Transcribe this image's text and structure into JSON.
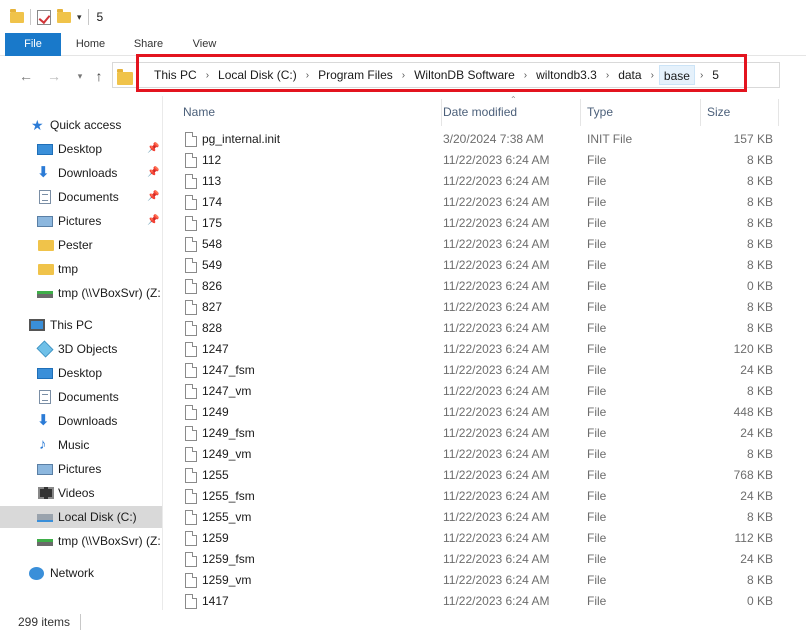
{
  "window": {
    "title": "5",
    "quick_access_dropdown": "▾"
  },
  "ribbon": {
    "tabs": [
      {
        "label": "File"
      },
      {
        "label": "Home"
      },
      {
        "label": "Share"
      },
      {
        "label": "View"
      }
    ]
  },
  "address": {
    "crumbs": [
      "This PC",
      "Local Disk (C:)",
      "Program Files",
      "WiltonDB Software",
      "wiltondb3.3",
      "data",
      "base",
      "5"
    ],
    "active_crumb": "base",
    "highlight_color": "#e3141f"
  },
  "nav": {
    "items": [
      {
        "label": "Quick access",
        "icon": "star-icon",
        "pinned": false
      },
      {
        "label": "Desktop",
        "icon": "desktop-icon",
        "pinned": true
      },
      {
        "label": "Downloads",
        "icon": "download-icon",
        "pinned": true
      },
      {
        "label": "Documents",
        "icon": "documents-icon",
        "pinned": true
      },
      {
        "label": "Pictures",
        "icon": "pictures-icon",
        "pinned": true
      },
      {
        "label": "Pester",
        "icon": "folder-icon",
        "pinned": false
      },
      {
        "label": "tmp",
        "icon": "folder-icon",
        "pinned": false
      },
      {
        "label": "tmp (\\\\VBoxSvr) (Z:",
        "icon": "network-drive-icon",
        "pinned": false
      },
      {
        "label": "This PC",
        "icon": "computer-icon",
        "pinned": false
      },
      {
        "label": "3D Objects",
        "icon": "3d-objects-icon",
        "pinned": false
      },
      {
        "label": "Desktop",
        "icon": "desktop-icon",
        "pinned": false
      },
      {
        "label": "Documents",
        "icon": "documents-icon",
        "pinned": false
      },
      {
        "label": "Downloads",
        "icon": "download-icon",
        "pinned": false
      },
      {
        "label": "Music",
        "icon": "music-icon",
        "pinned": false
      },
      {
        "label": "Pictures",
        "icon": "pictures-icon",
        "pinned": false
      },
      {
        "label": "Videos",
        "icon": "videos-icon",
        "pinned": false
      },
      {
        "label": "Local Disk (C:)",
        "icon": "local-disk-icon",
        "pinned": false,
        "selected": true
      },
      {
        "label": "tmp (\\\\VBoxSvr) (Z:",
        "icon": "network-drive-icon",
        "pinned": false
      },
      {
        "label": "Network",
        "icon": "network-icon",
        "pinned": false
      }
    ]
  },
  "columns": {
    "name": "Name",
    "date": "Date modified",
    "type": "Type",
    "size": "Size"
  },
  "files": [
    {
      "name": "pg_internal.init",
      "date": "3/20/2024 7:38 AM",
      "type": "INIT File",
      "size": "157 KB"
    },
    {
      "name": "112",
      "date": "11/22/2023 6:24 AM",
      "type": "File",
      "size": "8 KB"
    },
    {
      "name": "113",
      "date": "11/22/2023 6:24 AM",
      "type": "File",
      "size": "8 KB"
    },
    {
      "name": "174",
      "date": "11/22/2023 6:24 AM",
      "type": "File",
      "size": "8 KB"
    },
    {
      "name": "175",
      "date": "11/22/2023 6:24 AM",
      "type": "File",
      "size": "8 KB"
    },
    {
      "name": "548",
      "date": "11/22/2023 6:24 AM",
      "type": "File",
      "size": "8 KB"
    },
    {
      "name": "549",
      "date": "11/22/2023 6:24 AM",
      "type": "File",
      "size": "8 KB"
    },
    {
      "name": "826",
      "date": "11/22/2023 6:24 AM",
      "type": "File",
      "size": "0 KB"
    },
    {
      "name": "827",
      "date": "11/22/2023 6:24 AM",
      "type": "File",
      "size": "8 KB"
    },
    {
      "name": "828",
      "date": "11/22/2023 6:24 AM",
      "type": "File",
      "size": "8 KB"
    },
    {
      "name": "1247",
      "date": "11/22/2023 6:24 AM",
      "type": "File",
      "size": "120 KB"
    },
    {
      "name": "1247_fsm",
      "date": "11/22/2023 6:24 AM",
      "type": "File",
      "size": "24 KB"
    },
    {
      "name": "1247_vm",
      "date": "11/22/2023 6:24 AM",
      "type": "File",
      "size": "8 KB"
    },
    {
      "name": "1249",
      "date": "11/22/2023 6:24 AM",
      "type": "File",
      "size": "448 KB"
    },
    {
      "name": "1249_fsm",
      "date": "11/22/2023 6:24 AM",
      "type": "File",
      "size": "24 KB"
    },
    {
      "name": "1249_vm",
      "date": "11/22/2023 6:24 AM",
      "type": "File",
      "size": "8 KB"
    },
    {
      "name": "1255",
      "date": "11/22/2023 6:24 AM",
      "type": "File",
      "size": "768 KB"
    },
    {
      "name": "1255_fsm",
      "date": "11/22/2023 6:24 AM",
      "type": "File",
      "size": "24 KB"
    },
    {
      "name": "1255_vm",
      "date": "11/22/2023 6:24 AM",
      "type": "File",
      "size": "8 KB"
    },
    {
      "name": "1259",
      "date": "11/22/2023 6:24 AM",
      "type": "File",
      "size": "112 KB"
    },
    {
      "name": "1259_fsm",
      "date": "11/22/2023 6:24 AM",
      "type": "File",
      "size": "24 KB"
    },
    {
      "name": "1259_vm",
      "date": "11/22/2023 6:24 AM",
      "type": "File",
      "size": "8 KB"
    },
    {
      "name": "1417",
      "date": "11/22/2023 6:24 AM",
      "type": "File",
      "size": "0 KB"
    }
  ],
  "status": {
    "item_count": "299 items"
  },
  "colors": {
    "file_tab": "#1979ca",
    "selected_nav": "#d9d9d9",
    "header_text": "#4c607a"
  }
}
